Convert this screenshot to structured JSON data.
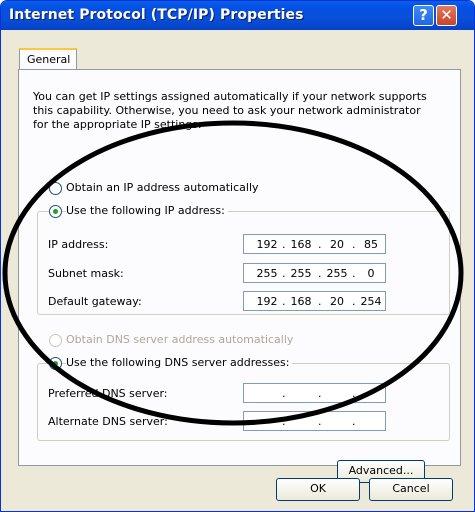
{
  "window": {
    "title": "Internet Protocol (TCP/IP) Properties",
    "help_glyph": "?",
    "close_glyph": "✕"
  },
  "tabs": [
    {
      "label": "General"
    }
  ],
  "intro_text": "You can get IP settings assigned automatically if your network supports this capability. Otherwise, you need to ask your network administrator for the appropriate IP settings.",
  "ip_section": {
    "auto_label": "Obtain an IP address automatically",
    "manual_label": "Use the following IP address:",
    "fields": [
      {
        "label": "IP address:",
        "octets": [
          "192",
          "168",
          "20",
          "85"
        ]
      },
      {
        "label": "Subnet mask:",
        "octets": [
          "255",
          "255",
          "255",
          "0"
        ]
      },
      {
        "label": "Default gateway:",
        "octets": [
          "192",
          "168",
          "20",
          "254"
        ]
      }
    ]
  },
  "dns_section": {
    "auto_label": "Obtain DNS server address automatically",
    "manual_label": "Use the following DNS server addresses:",
    "fields": [
      {
        "label": "Preferred DNS server:",
        "octets": [
          "",
          "",
          "",
          ""
        ]
      },
      {
        "label": "Alternate DNS server:",
        "octets": [
          "",
          "",
          "",
          ""
        ]
      }
    ]
  },
  "buttons": {
    "advanced": "Advanced...",
    "ok": "OK",
    "cancel": "Cancel"
  },
  "colors": {
    "titlebar": "#0a4fd8",
    "selected_radio": "#21a121",
    "annotation_oval": "#000000"
  }
}
